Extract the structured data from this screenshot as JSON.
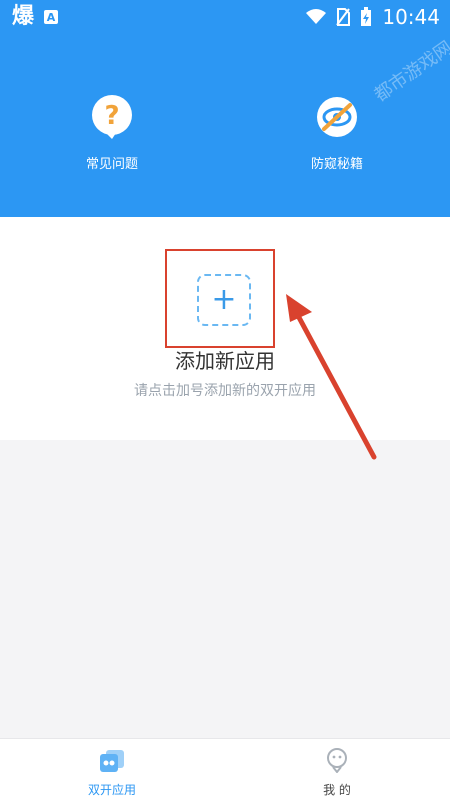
{
  "status_bar": {
    "app_logo": "爆",
    "notification_badge": "A",
    "time": "10:44",
    "watermark": "都市游戏网"
  },
  "header": {
    "background_color": "#2c97f3",
    "items": [
      {
        "label": "常见问题",
        "icon": "question-bubble-icon"
      },
      {
        "label": "防窥秘籍",
        "icon": "no-eye-icon"
      }
    ]
  },
  "add_app": {
    "plus_symbol": "+",
    "title": "添加新应用",
    "subtitle": "请点击加号添加新的双开应用"
  },
  "bottom_nav": {
    "items": [
      {
        "label": "双开应用",
        "icon": "dual-apps-icon",
        "active": true
      },
      {
        "label": "我 的",
        "icon": "profile-icon",
        "active": false
      }
    ]
  },
  "colors": {
    "accent": "#2c97f3",
    "highlight_red": "#d9422e",
    "question_orange": "#f1a33a"
  }
}
